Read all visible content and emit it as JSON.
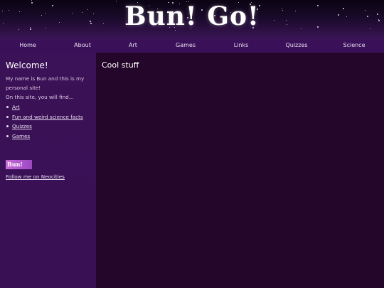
{
  "site": {
    "logo": "Bun! Go!"
  },
  "nav": [
    "Home",
    "About",
    "Art",
    "Games",
    "Links",
    "Quizzes",
    "Science"
  ],
  "sidebar": {
    "heading": "Welcome!",
    "intro": [
      "My name is Bun and this is my personal site!",
      "On this site, you will find..."
    ],
    "items": [
      "Art",
      "Fun and weird science facts",
      "Quizzes",
      "Games"
    ],
    "badge_text": "Bun!",
    "follow": "Follow me on Neocities"
  },
  "main": {
    "title": "Cool stuff"
  },
  "colors": {
    "header_bg": "#1a0a2a",
    "nav_bg": "#3a1158",
    "sidebar_bg": "#3b1157",
    "main_bg": "#24062a",
    "badge": "#c86ad8"
  }
}
